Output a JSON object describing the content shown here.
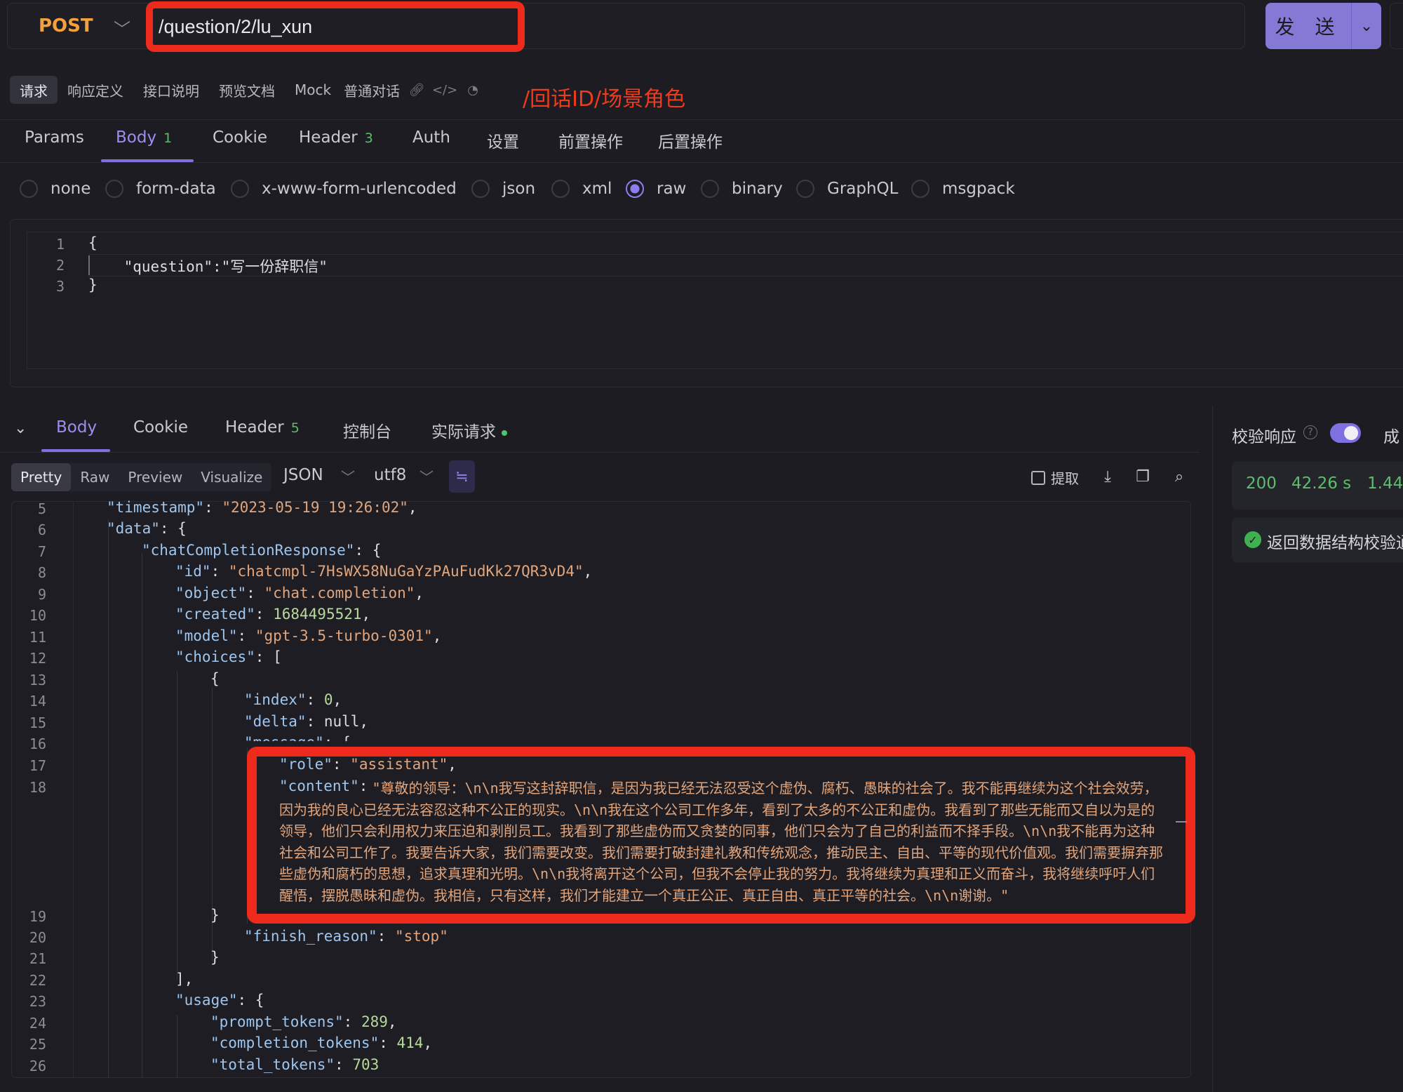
{
  "request": {
    "method": "POST",
    "url": "/question/2/lu_xun",
    "send_label": "发 送"
  },
  "doc_tabs": [
    {
      "label": "请求",
      "active": true
    },
    {
      "label": "响应定义"
    },
    {
      "label": "接口说明"
    },
    {
      "label": "预览文档"
    },
    {
      "label": "Mock"
    },
    {
      "label": "普通对话"
    }
  ],
  "annotation": "/回话ID/场景角色",
  "request_tabs": [
    {
      "label": "Params"
    },
    {
      "label": "Body",
      "badge": "1",
      "active": true
    },
    {
      "label": "Cookie"
    },
    {
      "label": "Header",
      "badge": "3"
    },
    {
      "label": "Auth"
    },
    {
      "label": "设置"
    },
    {
      "label": "前置操作"
    },
    {
      "label": "后置操作"
    }
  ],
  "body_types": [
    "none",
    "form-data",
    "x-www-form-urlencoded",
    "json",
    "xml",
    "raw",
    "binary",
    "GraphQL",
    "msgpack"
  ],
  "body_type_selected": "raw",
  "request_body": {
    "lines": [
      "{",
      "    \"question\":\"写一份辞职信\"",
      "}"
    ],
    "line_numbers": [
      "1",
      "2",
      "3"
    ]
  },
  "response_tabs": [
    {
      "label": "Body",
      "active": true
    },
    {
      "label": "Cookie"
    },
    {
      "label": "Header",
      "badge": "5"
    },
    {
      "label": "控制台"
    },
    {
      "label": "实际请求"
    }
  ],
  "view_modes": [
    "Pretty",
    "Raw",
    "Preview",
    "Visualize"
  ],
  "view_mode_selected": "Pretty",
  "format": "JSON",
  "encoding": "utf8",
  "extract_label": "提取",
  "response_body": {
    "line_numbers": [
      "5",
      "6",
      "7",
      "8",
      "9",
      "10",
      "11",
      "12",
      "13",
      "14",
      "15",
      "16",
      "17",
      "18",
      "19",
      "20",
      "21",
      "22",
      "23",
      "24",
      "25",
      "26"
    ],
    "timestamp": "2023-05-19 19:26:02",
    "id": "chatcmpl-7HsWX58NuGaYzPAuFudKk27QR3vD4",
    "object": "chat.completion",
    "created": "1684495521",
    "model": "gpt-3.5-turbo-0301",
    "index": "0",
    "delta": "null",
    "role": "assistant",
    "content": "\"尊敬的领导：\\n\\n我写这封辞职信，是因为我已经无法忍受这个虚伪、腐朽、愚昧的社会了。我不能再继续为这个社会效劳，因为我的良心已经无法容忍这种不公正的现实。\\n\\n我在这个公司工作多年，看到了太多的不公正和虚伪。我看到了那些无能而又自以为是的领导，他们只会利用权力来压迫和剥削员工。我看到了那些虚伪而又贪婪的同事，他们只会为了自己的利益而不择手段。\\n\\n我不能再为这种社会和公司工作了。我要告诉大家，我们需要改变。我们需要打破封建礼教和传统观念，推动民主、自由、平等的现代价值观。我们需要摒弃那些虚伪和腐朽的思想，追求真理和光明。\\n\\n我将离开这个公司，但我不会停止我的努力。我将继续为真理和正义而奋斗，我将继续呼吁人们醒悟，摆脱愚昧和虚伪。我相信，只有这样，我们才能建立一个真正公正、真正自由、真正平等的社会。\\n\\n谢谢。\"",
    "finish_reason": "stop",
    "prompt_tokens": "289",
    "completion_tokens": "414",
    "total_tokens": "703"
  },
  "validation": {
    "label": "校验响应",
    "success_cut": "成",
    "status": "200",
    "time": "42.26 s",
    "size_cut": "1.44",
    "check_text": "返回数据结构校验通"
  }
}
